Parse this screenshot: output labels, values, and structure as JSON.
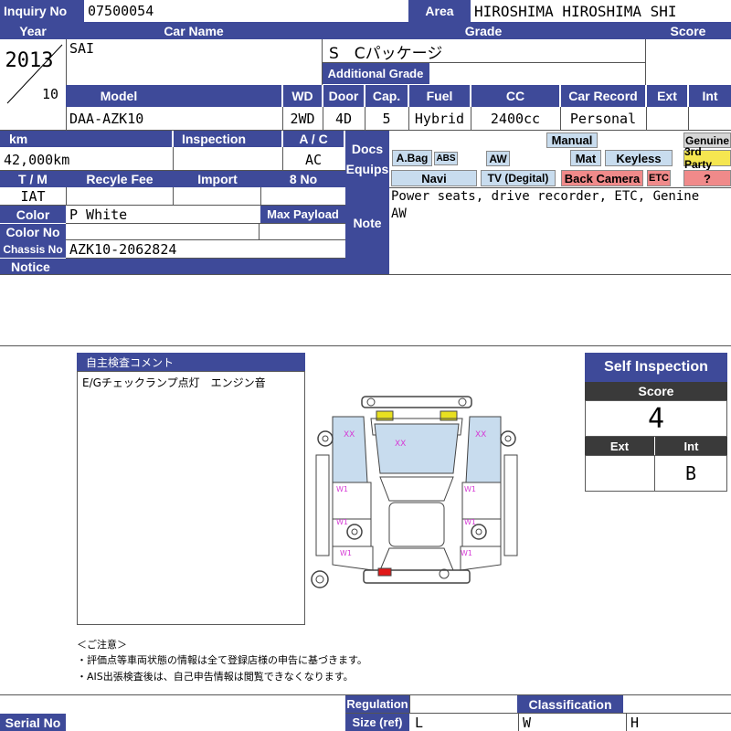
{
  "labels": {
    "inquiry_no": "Inquiry No",
    "area": "Area",
    "year": "Year",
    "car_name": "Car Name",
    "grade": "Grade",
    "score": "Score",
    "additional_grade": "Additional Grade",
    "model": "Model",
    "wd": "WD",
    "door": "Door",
    "cap": "Cap.",
    "fuel": "Fuel",
    "cc": "CC",
    "car_record": "Car Record",
    "ext": "Ext",
    "int": "Int",
    "km": "km",
    "inspection": "Inspection",
    "ac": "A / C",
    "docs": "Docs",
    "equips": "Equips",
    "tm": "T / M",
    "recyle_fee": "Recyle Fee",
    "import": "Import",
    "eight_no": "8 No",
    "color": "Color",
    "max_payload": "Max Payload",
    "note": "Note",
    "color_no": "Color No",
    "chassis_no": "Chassis No",
    "notice": "Notice",
    "serial_no": "Serial No",
    "regulation": "Regulation",
    "size_ref": "Size (ref)",
    "classification": "Classification"
  },
  "values": {
    "inquiry_no": "07500054",
    "area": "HIROSHIMA HIROSHIMA SHI",
    "year": "2013",
    "month": "10",
    "car_name": "SAI",
    "grade": "S　Cパッケージ",
    "model": "DAA-AZK10",
    "wd": "2WD",
    "door": "4D",
    "cap": "5",
    "fuel": "Hybrid",
    "cc": "2400cc",
    "car_record": "Personal",
    "km": "42,000km",
    "ac": "AC",
    "tm": "IAT",
    "color": "P White",
    "chassis_no": "AZK10-2062824",
    "note": "Power seats, drive recorder, ETC, Genine AW",
    "size_l": "L",
    "size_w": "W",
    "size_h": "H"
  },
  "equips": {
    "manual": "Manual",
    "genuine": "Genuine",
    "abag": "A.Bag",
    "abs": "ABS",
    "aw": "AW",
    "mat": "Mat",
    "keyless": "Keyless",
    "third_party": "3rd Party",
    "navi": "Navi",
    "tv": "TV (Degital)",
    "back_camera": "Back Camera",
    "etc": "ETC",
    "question": "?"
  },
  "self_comment": {
    "title": "自主検査コメント",
    "text": "E/Gチェックランプ点灯　エンジン音"
  },
  "self_inspection": {
    "title": "Self Inspection",
    "score_label": "Score",
    "score": "4",
    "ext_label": "Ext",
    "int_label": "Int",
    "ext": "",
    "int": "B"
  },
  "damage_marks": {
    "xx": "XX",
    "w1": "W1"
  },
  "notes": {
    "title": "＜ご注意＞",
    "line1": "・評価点等車両状態の情報は全て登録店様の申告に基づきます。",
    "line2": "・AIS出張検査後は、自己申告情報は閲覧できなくなります。"
  },
  "colors": {
    "header": "#3e4a99",
    "mark": "#d63ad6",
    "panel_blue": "#c8dcee",
    "lamp_yellow": "#e8e020",
    "lamp_red": "#e01818"
  }
}
